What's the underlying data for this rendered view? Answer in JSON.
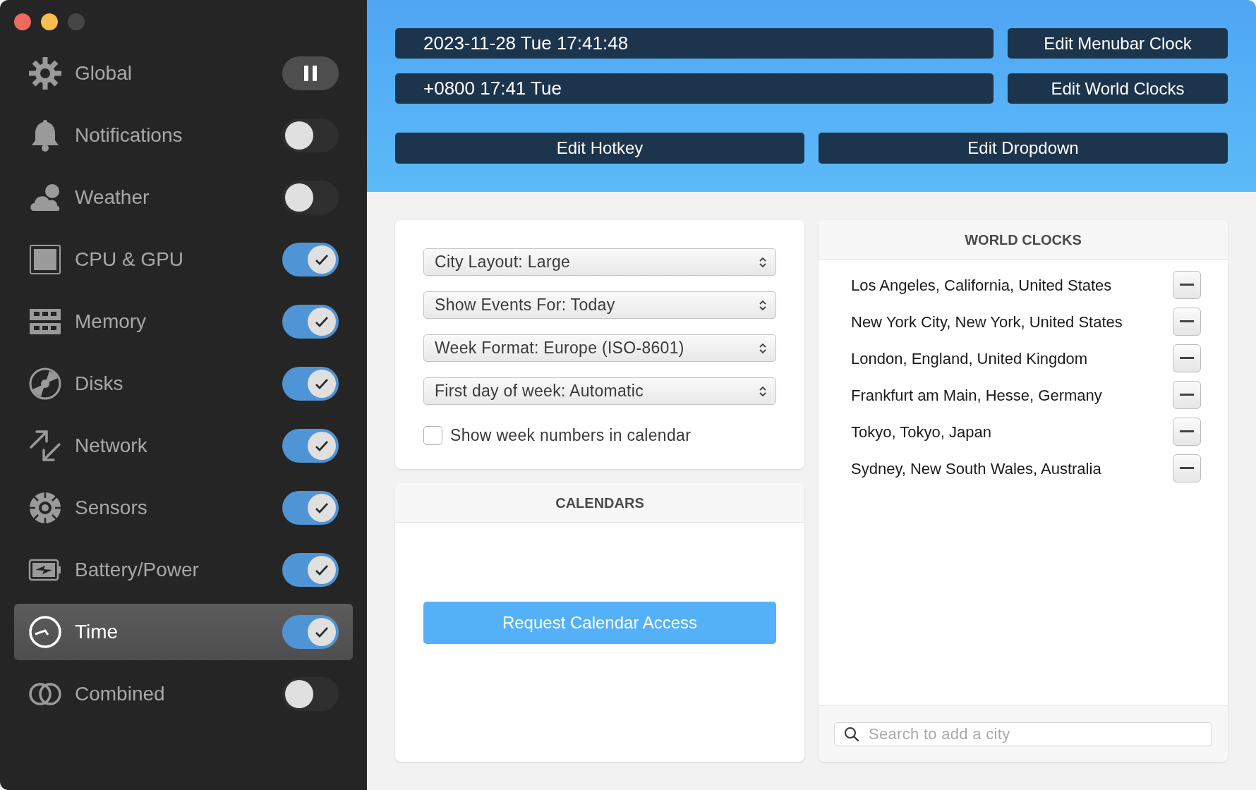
{
  "sidebar": {
    "items": [
      {
        "label": "Global",
        "kind": "pause",
        "selected": false
      },
      {
        "label": "Notifications",
        "kind": "switch",
        "on": false,
        "selected": false
      },
      {
        "label": "Weather",
        "kind": "switch",
        "on": false,
        "selected": false
      },
      {
        "label": "CPU & GPU",
        "kind": "switch",
        "on": true,
        "selected": false
      },
      {
        "label": "Memory",
        "kind": "switch",
        "on": true,
        "selected": false
      },
      {
        "label": "Disks",
        "kind": "switch",
        "on": true,
        "selected": false
      },
      {
        "label": "Network",
        "kind": "switch",
        "on": true,
        "selected": false
      },
      {
        "label": "Sensors",
        "kind": "switch",
        "on": true,
        "selected": false
      },
      {
        "label": "Battery/Power",
        "kind": "switch",
        "on": true,
        "selected": false
      },
      {
        "label": "Time",
        "kind": "switch",
        "on": true,
        "selected": true
      },
      {
        "label": "Combined",
        "kind": "switch",
        "on": false,
        "selected": false
      }
    ]
  },
  "header": {
    "menubar_clock": {
      "value": "2023-11-28 Tue 17:41:48",
      "button": "Edit Menubar Clock"
    },
    "world_clock": {
      "value": "+0800 17:41 Tue",
      "button": "Edit World Clocks"
    },
    "buttons": [
      "Edit Hotkey",
      "Edit Dropdown"
    ]
  },
  "settings": {
    "dropdowns": [
      "City Layout: Large",
      "Show Events For: Today",
      "Week Format: Europe (ISO-8601)",
      "First day of week: Automatic"
    ],
    "checkbox": {
      "label": "Show week numbers in calendar",
      "checked": false
    }
  },
  "calendars": {
    "title": "CALENDARS",
    "button": "Request Calendar Access"
  },
  "world_clocks": {
    "title": "WORLD CLOCKS",
    "cities": [
      "Los Angeles, California, United States",
      "New York City, New York, United States",
      "London, England, United Kingdom",
      "Frankfurt am Main, Hesse, Germany",
      "Tokyo, Tokyo, Japan",
      "Sydney, New South Wales, Australia"
    ],
    "search": {
      "placeholder": "Search to add a city"
    }
  }
}
